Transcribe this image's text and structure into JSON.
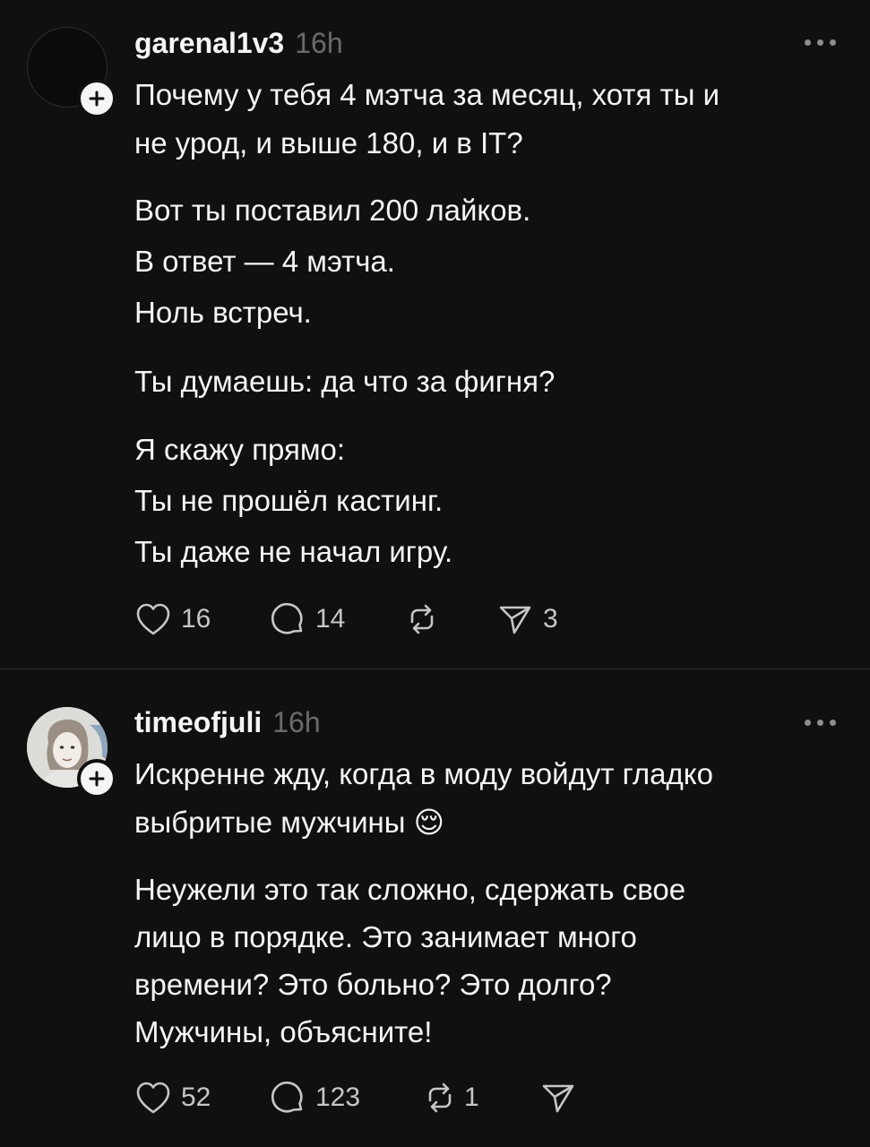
{
  "posts": [
    {
      "username": "garenal1v3",
      "time": "16h",
      "lines": [
        "Почему у тебя 4 мэтча за месяц, хотя ты и",
        "не урод, и выше 180, и в IT?",
        "Вот ты поставил 200 лайков.",
        "В ответ — 4 мэтча.",
        "Ноль встреч.",
        "Ты думаешь: да что за фигня?",
        "Я скажу прямо:",
        "Ты не прошёл кастинг.",
        "Ты даже не начал игру."
      ],
      "likes": "16",
      "replies": "14",
      "reposts": "",
      "shares": "3"
    },
    {
      "username": "timeofjuli",
      "time": "16h",
      "lines": [
        "Искренне жду, когда в моду войдут гладко",
        "выбритые мужчины 😌",
        "Неужели это так сложно, сдержать свое",
        "лицо в порядке. Это занимает много",
        "времени? Это больно? Это долго?",
        "Мужчины, объясните!"
      ],
      "likes": "52",
      "replies": "123",
      "reposts": "1",
      "shares": ""
    }
  ],
  "icons": {
    "like": "heart-icon",
    "reply": "comment-icon",
    "repost": "repost-icon",
    "share": "send-icon",
    "more": "more-icon",
    "follow": "plus-icon"
  },
  "colors": {
    "background": "#101010",
    "text": "#f3f5f7",
    "secondary": "#6b6b6b",
    "divider": "#2d2d2d"
  }
}
